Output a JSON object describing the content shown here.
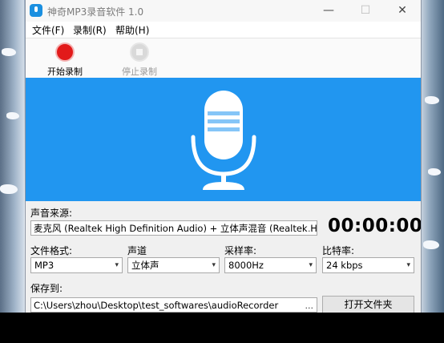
{
  "window": {
    "title": "神奇MP3录音软件 1.0",
    "minimize_glyph": "—",
    "maximize_glyph": "☐",
    "close_glyph": "✕"
  },
  "menu": {
    "file": "文件(F)",
    "record": "录制(R)",
    "help": "帮助(H)"
  },
  "toolbar": {
    "start_label": "开始录制",
    "stop_label": "停止录制"
  },
  "source": {
    "label": "声音来源:",
    "value": "麦克风 (Realtek High Definition Audio) + 立体声混音 (Realtek Hig",
    "browse": "..."
  },
  "timer": "00:00:00",
  "format": {
    "label": "文件格式:",
    "value": "MP3"
  },
  "channel": {
    "label": "声道",
    "value": "立体声"
  },
  "samplerate": {
    "label": "采样率:",
    "value": "8000Hz"
  },
  "bitrate": {
    "label": "比特率:",
    "value": "24 kbps"
  },
  "save": {
    "label": "保存到:",
    "path": "C:\\Users\\zhou\\Desktop\\test_softwares\\audioRecorder",
    "browse": "...",
    "open_folder": "打开文件夹"
  },
  "colors": {
    "banner": "#2196f0",
    "record": "#e21a1a"
  },
  "icons": {
    "dropdown": "▾"
  }
}
